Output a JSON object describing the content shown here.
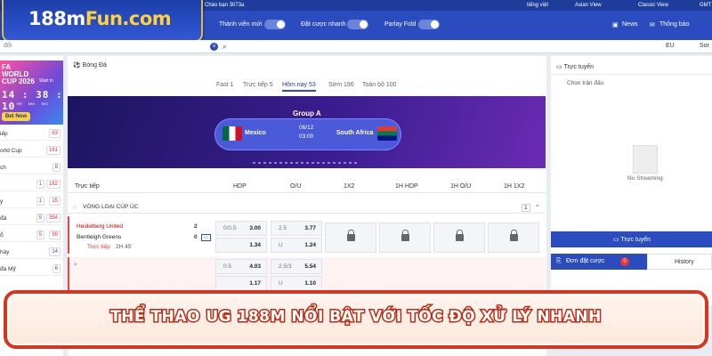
{
  "topbar": {
    "greeting": "Chào bạn 3073a",
    "language": "tiếng việt",
    "odds_view": "Asian View",
    "classic": "Classic View",
    "timezone": "GMT"
  },
  "logo": {
    "prefix": "188m",
    "suffix": "Fun.com"
  },
  "header": {
    "new_member": "Thành viên mới",
    "quick_bet": "Đặt cược nhanh",
    "parlay": "Parlay Fold",
    "news": "News",
    "notice": "Thông báo"
  },
  "search": {
    "placeholder": "đổi",
    "odds_format": "EU",
    "sort": "Sor"
  },
  "promo": {
    "title_line1": "FA",
    "title_line2": "WORLD",
    "title_line3": "CUP 2026",
    "start": "Start in",
    "countdown": "14 : 38 : 10",
    "units": "HR MIN SEC",
    "bet_now": "Bet Now"
  },
  "sidebar": {
    "items": [
      {
        "name": "iếp",
        "count": "63",
        "live": ""
      },
      {
        "name": "orld Cup",
        "count": "161",
        "live": ""
      },
      {
        "name": "ch",
        "count": "8",
        "live": ""
      },
      {
        "name": "",
        "count": "162",
        "live": "1"
      },
      {
        "name": "y",
        "count": "15",
        "live": "1"
      },
      {
        "name": "đá",
        "count": "354",
        "live": "5"
      },
      {
        "name": "ổ",
        "count": "99",
        "live": "5"
      },
      {
        "name": "hày",
        "count": "14",
        "live": ""
      },
      {
        "name": "đá Mỹ",
        "count": "6",
        "live": ""
      }
    ]
  },
  "main": {
    "sport": "Bóng Đá",
    "tabs": [
      "Fast 1",
      "Trực tiếp 5",
      "Hôm nay 53",
      "Sớm 196",
      "Toàn bộ 100"
    ],
    "banner": {
      "group": "Group A",
      "home": "Mexico",
      "away": "South Africa",
      "date": "06/12",
      "time": "03:00"
    },
    "columns": [
      "Trực tiếp",
      "HDP",
      "O/U",
      "1X2",
      "1H HDP",
      "1H O/U",
      "1H 1X2"
    ],
    "league": "VÒNG LOẠI CÚP ÚC",
    "league_count": "1",
    "match": {
      "home": "Heidelberg United",
      "away": "Bentleigh Greens",
      "home_score": "2",
      "away_score": "0",
      "status": "Trực tiếp",
      "clock": "2H 45'"
    },
    "odds": [
      {
        "hdp_line": "0/0.5",
        "hdp_home": "3.00",
        "hdp_away": "1.34",
        "ou_line": "2.5",
        "ou_over": "3.77",
        "ou_under_label": "U",
        "ou_under": "1.24"
      },
      {
        "hdp_line": "0.5",
        "hdp_home": "4.03",
        "hdp_away": "1.17",
        "ou_line": "2.5/3",
        "ou_over": "5.54",
        "ou_under_label": "U",
        "ou_under": "1.10"
      }
    ]
  },
  "right": {
    "live_title": "Trực tuyến",
    "choose": "Chọn trận đấu",
    "no_stream": "No Streaming",
    "live_button": "Trực tuyến",
    "bet_slip": "Đơn đặt cược",
    "bet_count": "0",
    "history": "History"
  },
  "footer": {
    "caption": "THỂ THAO UG 188M NỔI BẬT VỚI TỐC ĐỘ XỬ LÝ NHANH"
  },
  "colors": {
    "primary": "#2b4cbf",
    "accent": "#ffd23c",
    "live": "#d33",
    "footer_border": "#d6361e"
  }
}
